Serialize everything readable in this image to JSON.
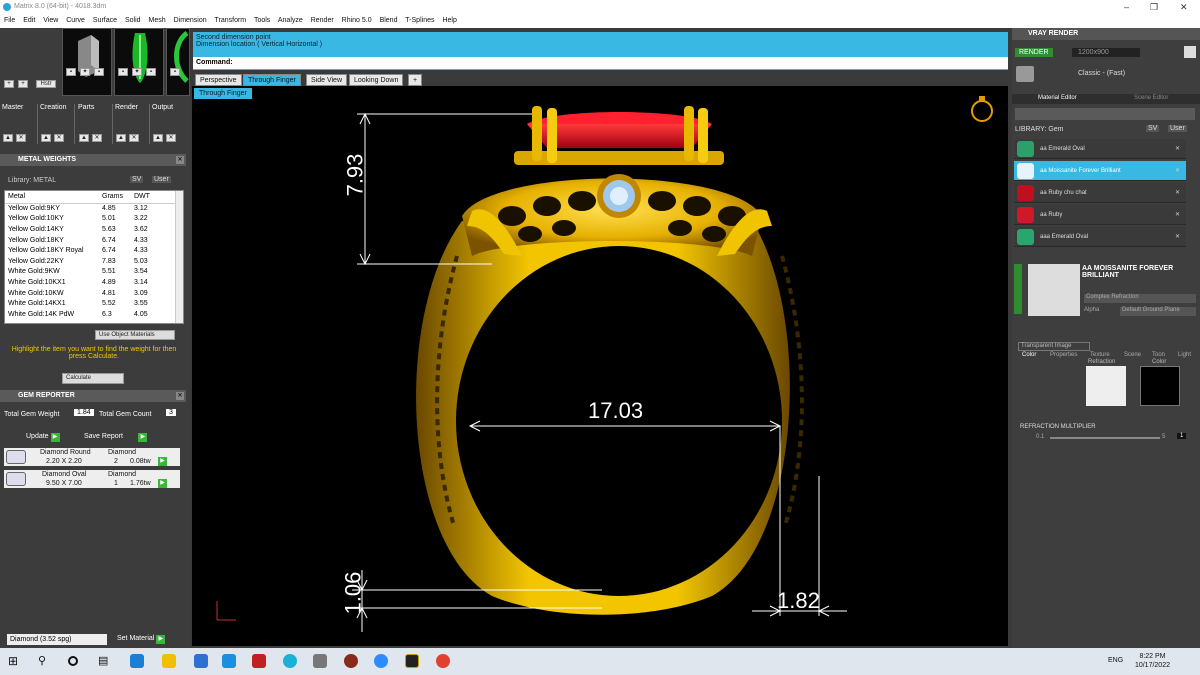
{
  "window": {
    "title": "Matrix 8.0 (64-bit) - 4018.3dm"
  },
  "menu": [
    "File",
    "Edit",
    "View",
    "Curve",
    "Surface",
    "Solid",
    "Mesh",
    "Dimension",
    "Transform",
    "Tools",
    "Analyze",
    "Render",
    "Rhino 5.0",
    "Blend",
    "T-Splines",
    "Help"
  ],
  "left": {
    "tabs": [
      "Master",
      "Creation",
      "Parts",
      "Render",
      "Output"
    ],
    "metal_weights": {
      "title": "METAL WEIGHTS",
      "library": "Library: METAL",
      "sv": "SV",
      "user": "User",
      "columns": [
        "Metal",
        "Grams",
        "DWT"
      ],
      "rows": [
        [
          "Yellow Gold:9KY",
          "4.85",
          "3.12"
        ],
        [
          "Yellow Gold:10KY",
          "5.01",
          "3.22"
        ],
        [
          "Yellow Gold:14KY",
          "5.63",
          "3.62"
        ],
        [
          "Yellow Gold:18KY",
          "6.74",
          "4.33"
        ],
        [
          "Yellow Gold:18KY Royal",
          "6.74",
          "4.33"
        ],
        [
          "Yellow Gold:22KY",
          "7.83",
          "5.03"
        ],
        [
          "White Gold:9KW",
          "5.51",
          "3.54"
        ],
        [
          "White Gold:10KX1",
          "4.89",
          "3.14"
        ],
        [
          "White Gold:10KW",
          "4.81",
          "3.09"
        ],
        [
          "White Gold:14KX1",
          "5.52",
          "3.55"
        ],
        [
          "White Gold:14K PdW",
          "6.3",
          "4.05"
        ]
      ],
      "use_object_materials": "Use Object Materials",
      "hint": "Highlight the item you want to find the weight for then press Calculate.",
      "calculate": "Calculate"
    },
    "gem_reporter": {
      "title": "GEM REPORTER",
      "total_weight_label": "Total Gem Weight",
      "total_weight": "1.84",
      "total_count_label": "Total Gem Count",
      "total_count": "3",
      "update": "Update",
      "save_report": "Save Report",
      "gems": [
        {
          "name": "Diamond Round",
          "size": "2.20 X 2.20",
          "material": "Diamond",
          "count": "2",
          "weight": "0.08tw"
        },
        {
          "name": "Diamond Oval",
          "size": "9.50 X 7.00",
          "material": "Diamond",
          "count": "1",
          "weight": "1.76tw"
        }
      ]
    },
    "material_select": "Diamond    (3.52 spg)",
    "set_material": "Set Material"
  },
  "command": {
    "line1": "Second dimension point",
    "line2": "Dimension location ( Vertical  Horizontal )",
    "label": "Command:"
  },
  "viewport": {
    "tabs": [
      "Perspective",
      "Through Finger",
      "Side View",
      "Looking Down"
    ],
    "active_label": "Through Finger",
    "dimensions": [
      "7.93",
      "17.03",
      "1.06",
      "1.82"
    ]
  },
  "right": {
    "title": "VRAY RENDER",
    "render": "RENDER",
    "resolution": "1200x900",
    "preset": "Classic - (Fast)",
    "tabs": [
      "Material Editor",
      "Scene Editor"
    ],
    "library": "LIBRARY: Gem",
    "sv": "SV",
    "user": "User",
    "library_items": [
      "aa Emerald Oval",
      "aa Moissanite Forever Brilliant",
      "aa Ruby chu chat",
      "aa Ruby",
      "aaa Emerald Oval"
    ],
    "material_name": "AA MOISSANITE FOREVER BRILLIANT",
    "refraction_mode": "Complex Refraction",
    "alpha": "Alpha",
    "ground_plane": "Default Ground Plane",
    "sub_tabs": [
      "Color",
      "Properties",
      "Texture",
      "Scene",
      "Toon",
      "Light"
    ],
    "transparent_image": "Transparent Image",
    "slot_refraction": "Refraction",
    "slot_color": "Color",
    "refraction_multiplier": "REFRACTION MULTIPLIER",
    "slider_min": "0.1",
    "slider_max": "5",
    "slider_value": "1",
    "colors": {
      "accent": "#39b8e3",
      "gold": "#e6b400",
      "ruby": "#d0101a"
    }
  },
  "taskbar": {
    "lang": "ENG",
    "time": "8:22 PM",
    "date": "10/17/2022"
  }
}
